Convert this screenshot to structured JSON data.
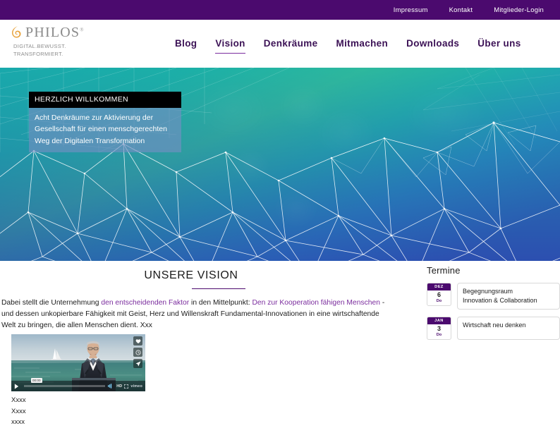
{
  "topbar": {
    "links": [
      {
        "label": "Impressum"
      },
      {
        "label": "Kontakt"
      },
      {
        "label": "Mitglieder-Login"
      }
    ]
  },
  "header": {
    "logo": {
      "wordmark": "PHILOS",
      "registered": "®",
      "tagline_line1": "DIGITAL.BEWUSST.",
      "tagline_line2": "TRANSFORMIERT.",
      "mark_icon": "flame-swirl-icon",
      "mark_color": "#e8a33d"
    },
    "nav": [
      {
        "label": "Blog",
        "active": false
      },
      {
        "label": "Vision",
        "active": true
      },
      {
        "label": "Denkräume",
        "active": false
      },
      {
        "label": "Mitmachen",
        "active": false
      },
      {
        "label": "Downloads",
        "active": false
      },
      {
        "label": "Über uns",
        "active": false
      }
    ],
    "accent_color": "#4b0a6e"
  },
  "hero": {
    "background_description": "teal-to-blue gradient with white low-poly network mesh",
    "gradient_from": "#1fae9a",
    "gradient_mid": "#3fc98a",
    "gradient_to": "#2a5fb8",
    "box": {
      "heading": "HERZLICH WILLKOMMEN",
      "body": "Acht Denkräume zur Aktivierung der Gesellschaft für einen menschgerechten Weg der Digitalen Transformation"
    }
  },
  "main": {
    "vision": {
      "title": "UNSERE VISION",
      "paragraph": {
        "seg1": "Dabei stellt die Unternehmung ",
        "link1": "den entscheidenden Faktor",
        "seg2": " in den Mittelpunkt: ",
        "link2": "Den zur Kooperation fähigen Menschen",
        "seg3": " - und dessen unkopierbare Fähigkeit mit Geist, Herz und Willenskraft Fundamental-Innovationen in eine wirtschaftende Welt zu bringen, die allen Menschen dient.  Xxx"
      },
      "link_color": "#7b2d9e"
    },
    "video": {
      "scene_description": "man in dark suit speaking at lectern in front of sea and sky",
      "play_icon": "play-icon",
      "time_tooltip": "00:00",
      "quality_label": "HD",
      "brand_label": "vimeo",
      "actions": [
        {
          "icon": "heart-icon"
        },
        {
          "icon": "clock-icon"
        },
        {
          "icon": "share-icon"
        }
      ]
    },
    "below_video_lines": [
      "Xxxx",
      "Xxxx",
      "xxxx"
    ]
  },
  "termine": {
    "title": "Termine",
    "events": [
      {
        "month": "DEZ",
        "day": "6",
        "weekday": "Do",
        "title_line1": "Begegnungsraum",
        "title_line2": "Innovation & Collaboration"
      },
      {
        "month": "JAN",
        "day": "3",
        "weekday": "Do",
        "title_line1": "Wirtschaft neu denken",
        "title_line2": ""
      }
    ]
  }
}
